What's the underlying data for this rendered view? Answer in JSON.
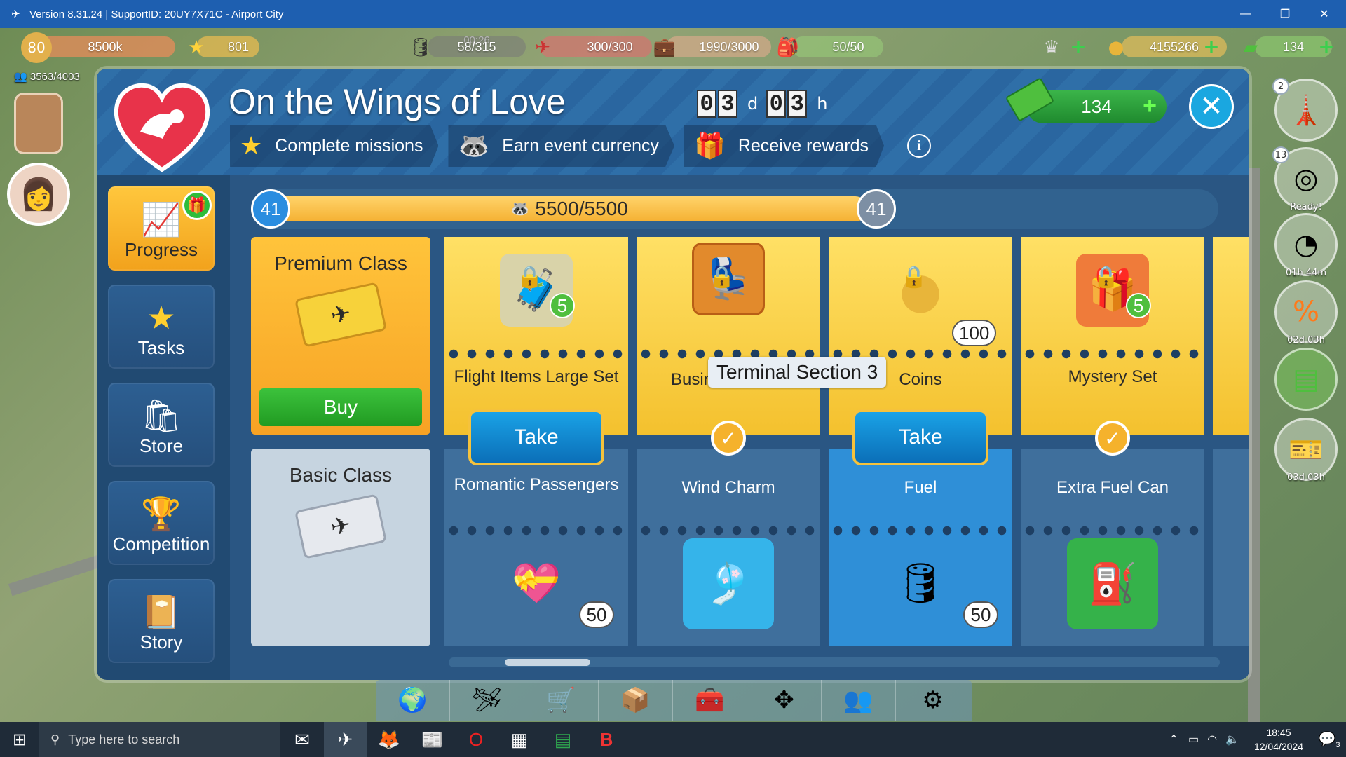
{
  "window": {
    "title": "Version 8.31.24 | SupportID: 20UY7X71C - Airport City",
    "minimize": "—",
    "restore": "❐",
    "close": "✕"
  },
  "hud": {
    "level": "80",
    "xp": "8500k",
    "stars": "801",
    "timer": "00:26",
    "fuel": "58/315",
    "cargo": "300/300",
    "passengers": "1990/3000",
    "crew": "50/50",
    "coins": "4155266",
    "cash": "134",
    "population": "3563/4003"
  },
  "side_right": {
    "badge_1": "2",
    "badge_2": "13",
    "ready": "Ready!",
    "timer_1": "01h 44m",
    "timer_2": "02d 03h",
    "timer_3": "03d 03h"
  },
  "event": {
    "title": "On the Wings of Love",
    "days": [
      "0",
      "3"
    ],
    "days_unit": "d",
    "hours": [
      "0",
      "3"
    ],
    "hours_unit": "h",
    "steps": [
      "Complete missions",
      "Earn event currency",
      "Receive rewards"
    ],
    "info": "i",
    "cash": "134",
    "close_icon": "close-icon"
  },
  "nav": [
    {
      "label": "Progress",
      "icon": "chart-arrow-icon",
      "active": true
    },
    {
      "label": "Tasks",
      "icon": "star-icon"
    },
    {
      "label": "Store",
      "icon": "shopping-bag-icon"
    },
    {
      "label": "Competition",
      "icon": "trophy-icon"
    },
    {
      "label": "Story",
      "icon": "book-icon"
    }
  ],
  "progress": {
    "level_left": "41",
    "level_right": "41",
    "text": "5500/5500",
    "fill": 1.0
  },
  "classes": {
    "premium": {
      "title": "Premium Class",
      "buy": "Buy"
    },
    "basic": {
      "title": "Basic Class"
    }
  },
  "rewards": [
    {
      "premium": "Flight Items Large Set",
      "premium_qty": "5",
      "basic": "Romantic Passengers",
      "basic_qty": "50",
      "action": "Take"
    },
    {
      "premium": "Business Class",
      "basic": "Wind Charm",
      "action": "check"
    },
    {
      "premium": "Coins",
      "premium_qty": "100",
      "basic": "Fuel",
      "basic_qty": "50",
      "action": "Take"
    },
    {
      "premium": "Mystery Set",
      "premium_qty": "5",
      "basic": "Extra Fuel Can",
      "action": "check"
    }
  ],
  "tooltip": "Terminal Section 3",
  "taskbar": {
    "search_placeholder": "Type here to search",
    "time": "18:45",
    "date": "12/04/2024",
    "notif": "3"
  },
  "colors": {
    "panel": "#214a72",
    "accent_gold": "#f5b22c",
    "take_blue": "#1aa2e6",
    "buy_green": "#3cc23c"
  }
}
